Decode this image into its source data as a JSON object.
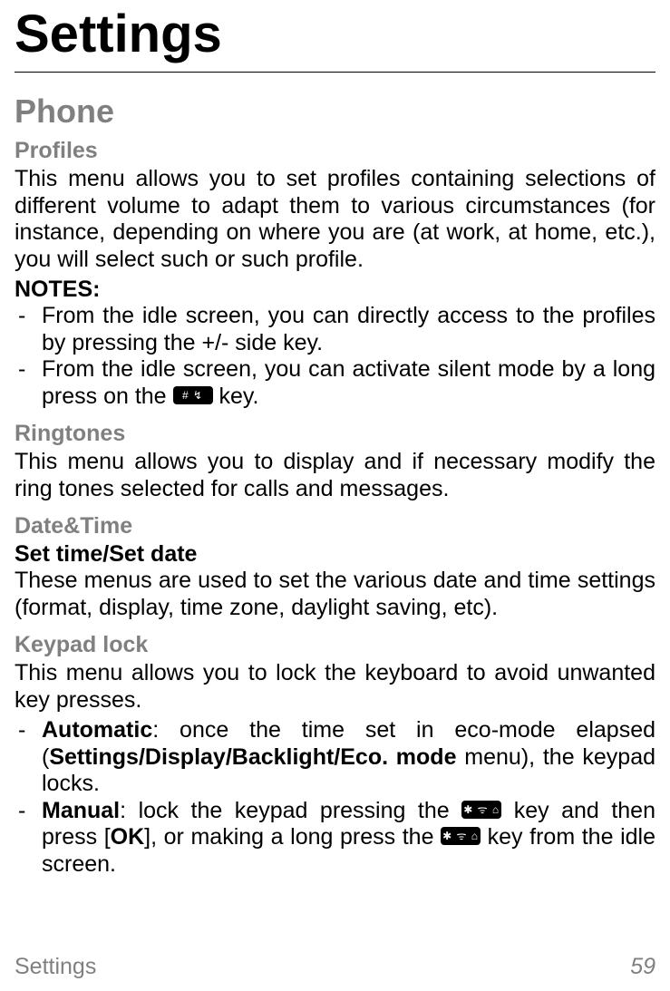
{
  "title": "Settings",
  "section": "Phone",
  "profiles": {
    "heading": "Profiles",
    "body": "This menu allows you to set profiles containing selections of different volume to adapt them to various circumstances (for instance, depending on where you are (at work, at home, etc.), you will select such or such profile.",
    "notes_label": "NOTES:",
    "note1": "From the idle screen, you can directly access to the profiles by pressing the +/- side key.",
    "note2_pre": "From the idle screen, you can activate silent mode by a long press on the ",
    "note2_key": "# ↯",
    "note2_post": " key."
  },
  "ringtones": {
    "heading": "Ringtones",
    "body": "This menu allows you to display and if necessary modify the ring tones selected for calls and messages."
  },
  "datetime": {
    "heading": "Date&Time",
    "subheading": "Set time/Set date",
    "body": "These menus are used to set the various date and time settings (format, display, time zone, daylight saving, etc)."
  },
  "keypad": {
    "heading": "Keypad lock",
    "body": "This menu allows you to lock the keyboard to avoid unwanted key presses.",
    "auto_label": "Automatic",
    "auto_text_pre": ": once the time set in eco-mode elapsed (",
    "auto_menu": "Settings/Display/Backlight/Eco. mode",
    "auto_text_post": " menu), the keypad locks.",
    "manual_label": "Manual",
    "manual_pre": ": lock the keypad pressing the ",
    "manual_key1": "✱ ᯤ ⌂",
    "manual_mid1": " key and then press [",
    "manual_ok": "OK",
    "manual_mid2": "], or making a long press the ",
    "manual_key2": "✱ ᯤ ⌂",
    "manual_post": " key from the idle screen."
  },
  "footer": {
    "label": "Settings",
    "page": "59"
  }
}
